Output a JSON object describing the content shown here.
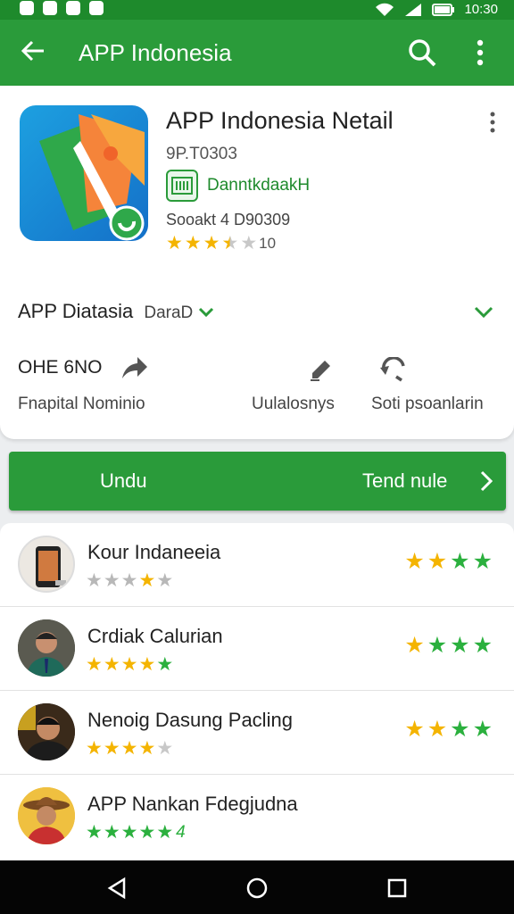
{
  "status_bar": {
    "time": "10:30"
  },
  "app_bar": {
    "title": "APP Indonesia",
    "back_icon": "arrow-left-icon",
    "search_icon": "search-icon",
    "menu_icon": "more-vert-icon"
  },
  "app": {
    "name": "APP Indonesia Netail",
    "version": "9P.T0303",
    "developer": "DanntkdaakH",
    "meta": "Sooakt 4 D90309",
    "rating_stars": 3.5,
    "rating_count": "10",
    "category_label": "APP Diatasia",
    "category_value": "DaraD"
  },
  "stats": {
    "value": "OHE 6NO",
    "label": "Fnapital Nominio",
    "action1_label": "Uulalosnys",
    "action2_label": "Soti psoanlarin"
  },
  "download": {
    "label": "Undu",
    "secondary_label": "Tend nule"
  },
  "reviews": [
    {
      "name": "Kour Indaneeia",
      "stars": 4,
      "rating": 4
    },
    {
      "name": "Crdiak Calurian",
      "stars": 5,
      "rating": 4
    },
    {
      "name": "Nenoig Dasung Pacling",
      "stars": 4,
      "rating": 4
    },
    {
      "name": "APP Nankan Fdegjudna",
      "stars": 5,
      "extra": "4"
    }
  ],
  "colors": {
    "primary": "#2a9b3a",
    "dark_primary": "#1e8a2c",
    "star_gold": "#f4b400",
    "star_green": "#2bb03e"
  }
}
